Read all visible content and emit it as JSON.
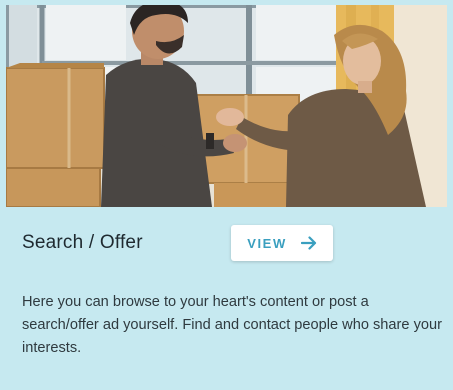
{
  "card": {
    "image": {
      "icon": "photo-two-people-handshake-moving-boxes"
    },
    "title": "Search / Offer",
    "view_button": {
      "label": "VIEW",
      "icon": "arrow-right-icon"
    },
    "description": "Here you can browse to your heart's content or post a search/offer ad yourself. Find and contact people who share your interests."
  },
  "colors": {
    "card_background": "#c6e9f0",
    "button_text": "#3a9fbf",
    "title_text": "#1f2a30",
    "body_text": "#2f3a3f"
  }
}
